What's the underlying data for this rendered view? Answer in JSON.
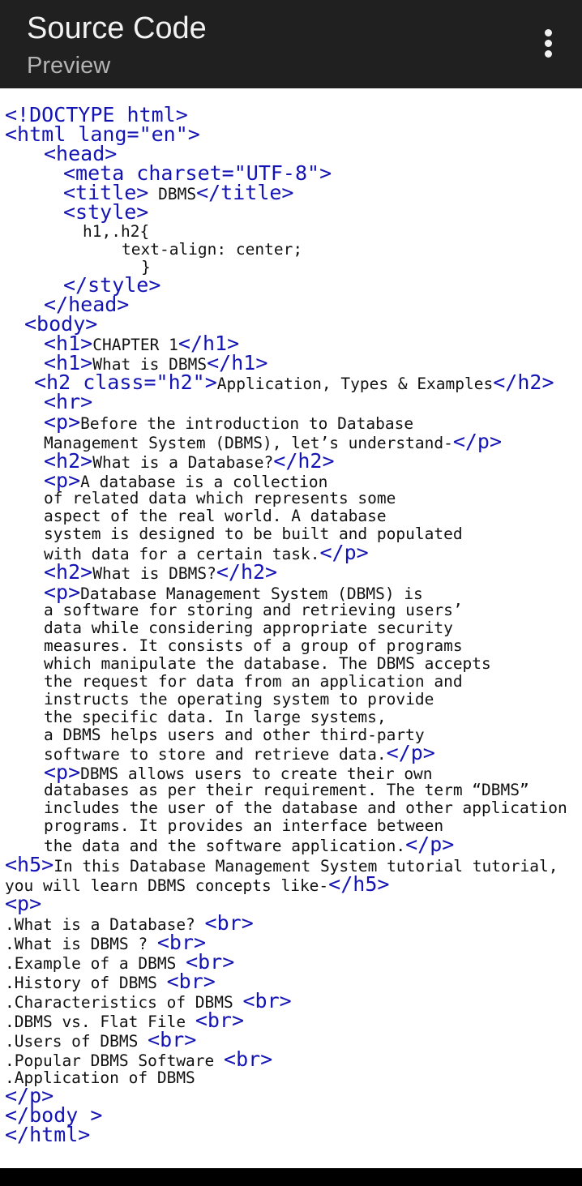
{
  "header": {
    "title": "Source Code",
    "subtitle": "Preview",
    "menu_icon": "more-vert-icon"
  },
  "code_lines": [
    [
      {
        "t": "<!DOCTYPE html>",
        "k": "tb"
      }
    ],
    [
      {
        "t": "<html lang=\"en\">",
        "k": "tb"
      }
    ],
    [
      {
        "t": "<head>",
        "k": "tb"
      }
    ],
    [
      {
        "t": "<meta charset=\"UTF-8\">",
        "k": "tb"
      }
    ],
    [
      {
        "t": "<title>",
        "k": "tb"
      },
      {
        "t": " DBMS",
        "k": "ct"
      },
      {
        "t": "</title>",
        "k": "tb"
      }
    ],
    [
      {
        "t": "<style>",
        "k": "tb"
      }
    ],
    [
      {
        "t": "h1,.h2{",
        "k": "ct"
      }
    ],
    [
      {
        "t": "text-align: center;",
        "k": "ct"
      }
    ],
    [
      {
        "t": "}",
        "k": "ct"
      }
    ],
    [
      {
        "t": "</style>",
        "k": "tb"
      }
    ],
    [
      {
        "t": "</head>",
        "k": "tb"
      }
    ],
    [
      {
        "t": "<body>",
        "k": "tb"
      }
    ],
    [
      {
        "t": "<h1>",
        "k": "tb"
      },
      {
        "t": "CHAPTER 1",
        "k": "ct"
      },
      {
        "t": "</h1>",
        "k": "tb"
      }
    ],
    [
      {
        "t": "<h1>",
        "k": "tb"
      },
      {
        "t": "What is DBMS",
        "k": "ct"
      },
      {
        "t": "</h1>",
        "k": "tb"
      }
    ],
    [
      {
        "t": "<h2 class=\"h2\">",
        "k": "tb"
      },
      {
        "t": "Application, Types & Examples",
        "k": "ct"
      },
      {
        "t": "</h2>",
        "k": "tb"
      }
    ],
    [
      {
        "t": "<hr>",
        "k": "tb"
      }
    ],
    [
      {
        "t": "<p>",
        "k": "tb"
      },
      {
        "t": "Before the introduction to Database",
        "k": "ct"
      }
    ],
    [
      {
        "t": "Management System (DBMS), let’s understand-",
        "k": "ct"
      },
      {
        "t": "</p>",
        "k": "tb"
      }
    ],
    [
      {
        "t": "<h2>",
        "k": "tb"
      },
      {
        "t": "What is a Database?",
        "k": "ct"
      },
      {
        "t": "</h2>",
        "k": "tb"
      }
    ],
    [
      {
        "t": "<p>",
        "k": "tb"
      },
      {
        "t": "A database is a collection",
        "k": "ct"
      }
    ],
    [
      {
        "t": "of related data which represents some",
        "k": "ct"
      }
    ],
    [
      {
        "t": "aspect of the real world. A database",
        "k": "ct"
      }
    ],
    [
      {
        "t": "system is designed to be built and populated",
        "k": "ct"
      }
    ],
    [
      {
        "t": "with data for a certain task.",
        "k": "ct"
      },
      {
        "t": "</p>",
        "k": "tb"
      }
    ],
    [
      {
        "t": "<h2>",
        "k": "tb"
      },
      {
        "t": "What is DBMS?",
        "k": "ct"
      },
      {
        "t": "</h2>",
        "k": "tb"
      }
    ],
    [
      {
        "t": "<p>",
        "k": "tb"
      },
      {
        "t": "Database Management System (DBMS) is",
        "k": "ct"
      }
    ],
    [
      {
        "t": "a software for storing and retrieving users’",
        "k": "ct"
      }
    ],
    [
      {
        "t": "data while considering appropriate security",
        "k": "ct"
      }
    ],
    [
      {
        "t": "measures. It consists of a group of programs",
        "k": "ct"
      }
    ],
    [
      {
        "t": "which manipulate the database. The DBMS accepts",
        "k": "ct"
      }
    ],
    [
      {
        "t": "the request for data from an application and",
        "k": "ct"
      }
    ],
    [
      {
        "t": "instructs the operating system to provide",
        "k": "ct"
      }
    ],
    [
      {
        "t": "the specific data. In large systems,",
        "k": "ct"
      }
    ],
    [
      {
        "t": "a DBMS helps users and other third-party",
        "k": "ct"
      }
    ],
    [
      {
        "t": "software to store and retrieve data.",
        "k": "ct"
      },
      {
        "t": "</p>",
        "k": "tb"
      }
    ],
    [
      {
        "t": "<p>",
        "k": "tb"
      },
      {
        "t": "DBMS allows users to create their own",
        "k": "ct"
      }
    ],
    [
      {
        "t": "databases as per their requirement. The term “DBMS”",
        "k": "ct"
      }
    ],
    [
      {
        "t": "includes the user of the database and other application",
        "k": "ct"
      }
    ],
    [
      {
        "t": "programs. It provides an interface between",
        "k": "ct"
      }
    ],
    [
      {
        "t": "the data and the software application.",
        "k": "ct"
      },
      {
        "t": "</p>",
        "k": "tb"
      }
    ],
    [
      {
        "t": "<h5>",
        "k": "tb"
      },
      {
        "t": "In this Database Management System tutorial tutorial,",
        "k": "ct"
      }
    ],
    [
      {
        "t": "you will learn DBMS concepts like-",
        "k": "ct"
      },
      {
        "t": "</h5>",
        "k": "tb"
      }
    ],
    [
      {
        "t": "<p>",
        "k": "tb"
      }
    ],
    [
      {
        "t": ".What is a Database? ",
        "k": "ct"
      },
      {
        "t": "<br>",
        "k": "tb"
      }
    ],
    [
      {
        "t": ".What is DBMS ? ",
        "k": "ct"
      },
      {
        "t": "<br>",
        "k": "tb"
      }
    ],
    [
      {
        "t": ".Example of a DBMS ",
        "k": "ct"
      },
      {
        "t": "<br>",
        "k": "tb"
      }
    ],
    [
      {
        "t": ".History of DBMS ",
        "k": "ct"
      },
      {
        "t": "<br>",
        "k": "tb"
      }
    ],
    [
      {
        "t": ".Characteristics of DBMS ",
        "k": "ct"
      },
      {
        "t": "<br>",
        "k": "tb"
      }
    ],
    [
      {
        "t": ".DBMS vs. Flat File ",
        "k": "ct"
      },
      {
        "t": "<br>",
        "k": "tb"
      }
    ],
    [
      {
        "t": ".Users of DBMS ",
        "k": "ct"
      },
      {
        "t": "<br>",
        "k": "tb"
      }
    ],
    [
      {
        "t": ".Popular DBMS Software ",
        "k": "ct"
      },
      {
        "t": "<br>",
        "k": "tb"
      }
    ],
    [
      {
        "t": ".Application of DBMS",
        "k": "ct"
      }
    ],
    [
      {
        "t": "</p>",
        "k": "tb"
      }
    ],
    [
      {
        "t": "</body >",
        "k": "tb"
      }
    ],
    [
      {
        "t": "</html>",
        "k": "tb"
      }
    ]
  ]
}
